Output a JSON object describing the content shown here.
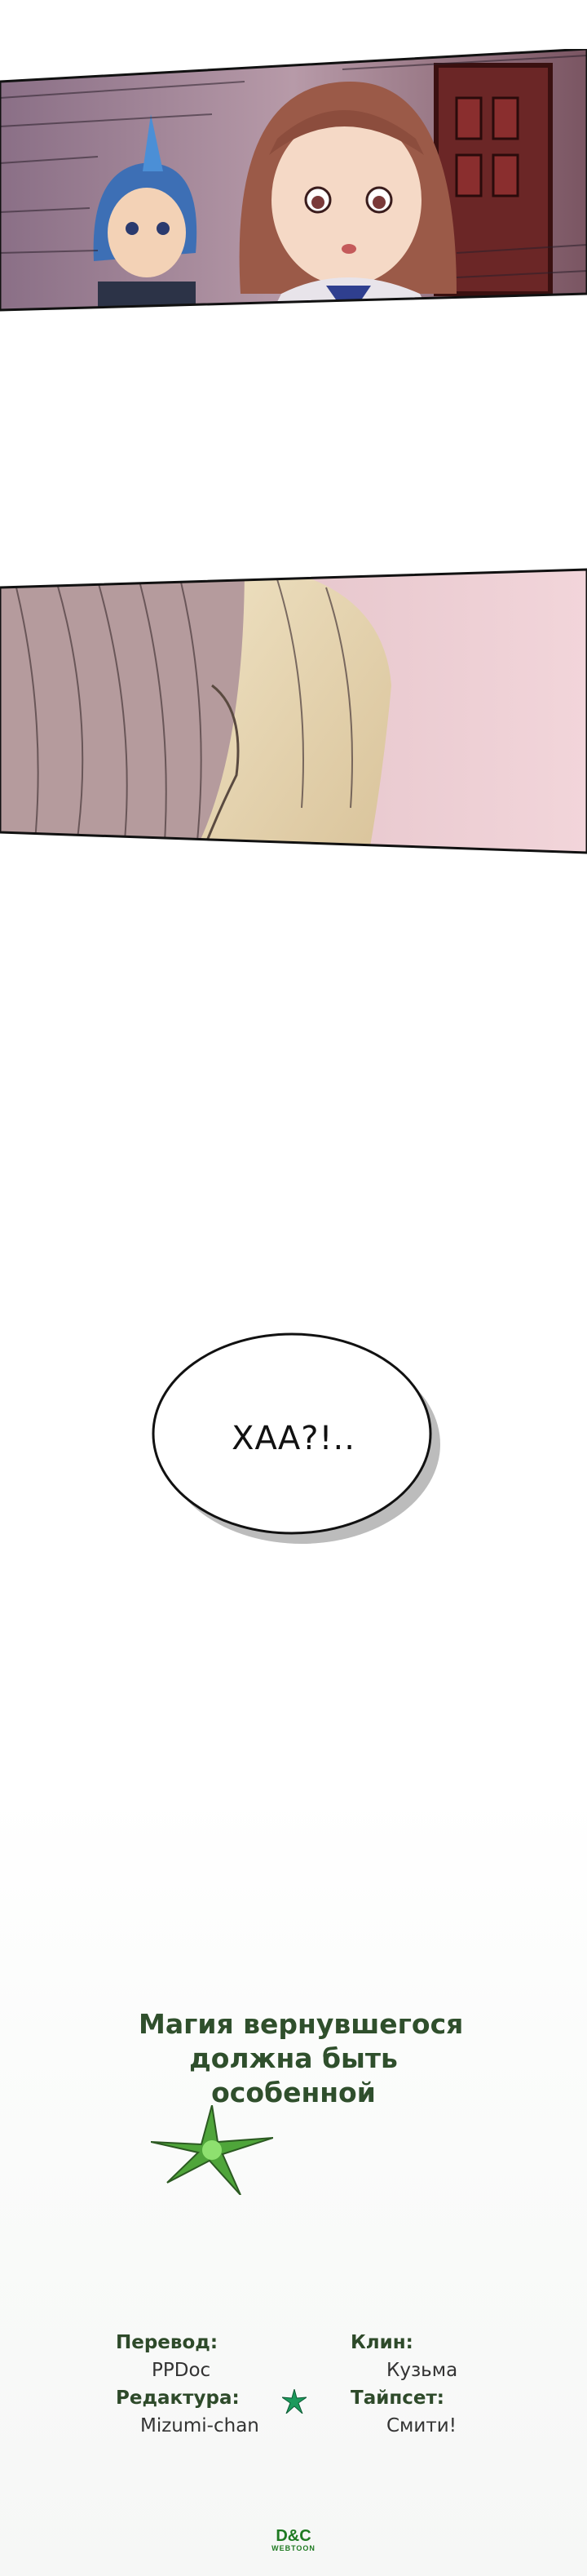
{
  "speech_bubble": {
    "text": "ХАА?!.."
  },
  "credits": {
    "title_lines": [
      "Магия вернувшегося",
      "должна быть",
      "особенной"
    ],
    "translation_label": "Перевод:",
    "translation_value": "PPDoc",
    "editing_label": "Редактура:",
    "editing_value": "Mizumi-chan",
    "cleaning_label": "Клин:",
    "cleaning_value": "Кузьма",
    "typesetting_label": "Тайпсет:",
    "typesetting_value": "Смити!"
  },
  "logo": {
    "main": "D&C",
    "sub": "WEBTOON"
  },
  "colors": {
    "title_green": "#2f4f2c",
    "logo_green": "#1f7a22",
    "star_green": "#4fa53a"
  }
}
